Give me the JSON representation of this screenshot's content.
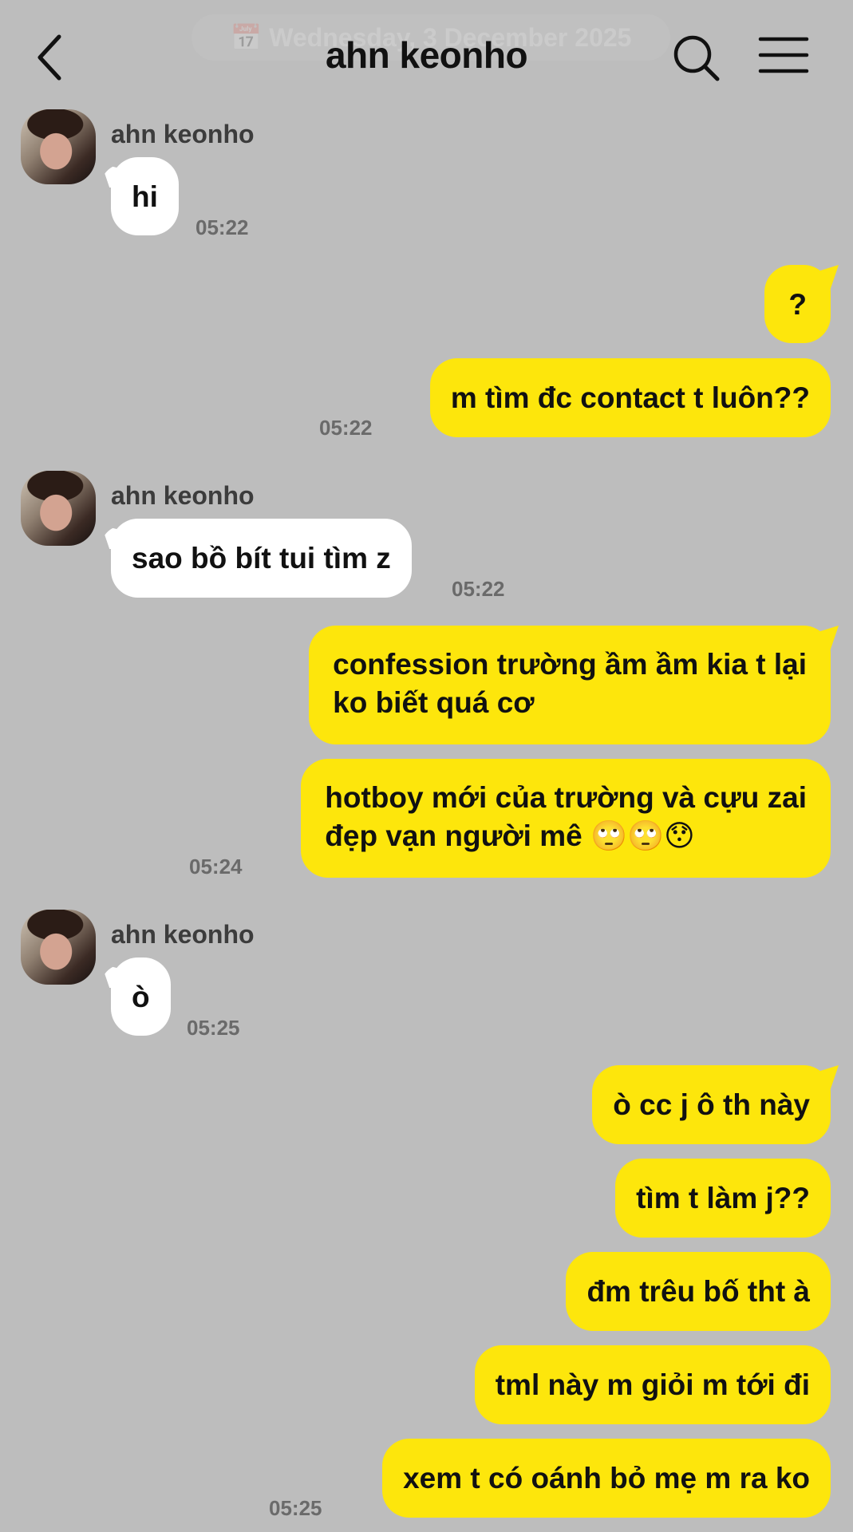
{
  "header": {
    "date_banner": "📅 Wednesday, 3 December 2025",
    "title": "ahn keonho"
  },
  "messages": [
    {
      "sender": "ahn keonho",
      "text": "hi",
      "time": "05:22"
    },
    {
      "text": "?"
    },
    {
      "text": "m tìm đc contact t luôn??",
      "time": "05:22"
    },
    {
      "sender": "ahn keonho",
      "text": "sao bồ bít tui tìm z",
      "time": "05:22"
    },
    {
      "text_line1": "confession trường ầm ầm kia t lại",
      "text_line2": "ko biết quá cơ"
    },
    {
      "text_line1": "hotboy mới của trường và cựu zai",
      "text_line2": "đẹp vạn người mê 🙄🙄😯",
      "time": "05:24"
    },
    {
      "sender": "ahn keonho",
      "text": "ò",
      "time": "05:25"
    },
    {
      "text": "ò cc j ô th này"
    },
    {
      "text": "tìm t làm j??"
    },
    {
      "text": "đm trêu bố tht à"
    },
    {
      "text": "tml này m giỏi m tới đi"
    },
    {
      "text": "xem t có oánh bỏ mẹ m ra ko",
      "time": "05:25"
    }
  ],
  "colors": {
    "background": "#bdbdbd",
    "outgoing_bubble": "#fde60c",
    "incoming_bubble": "#ffffff"
  },
  "icons": {
    "back": "chevron-left-icon",
    "search": "search-icon",
    "menu": "hamburger-menu-icon"
  }
}
